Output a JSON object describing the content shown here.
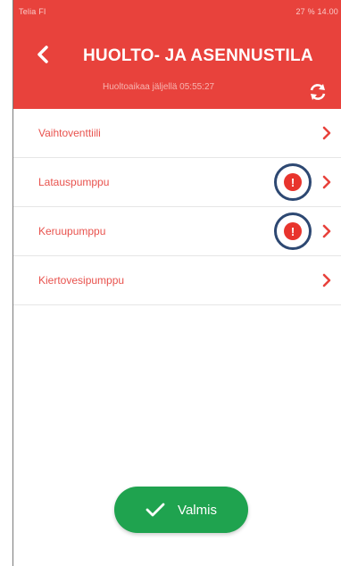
{
  "status_bar": {
    "left": "Telia FI",
    "right": "27 % 14.00"
  },
  "header": {
    "title": "HUOLTO- JA ASENNUSTILA",
    "subtitle": "Huoltoaikaa jäljellä 05:55:27",
    "back_icon": "chevron-left-icon",
    "sync_icon": "sync-icon",
    "background": "#e8423c"
  },
  "items": [
    {
      "label": "Vaihtoventtiili",
      "alert": false
    },
    {
      "label": "Latauspumppu",
      "alert": true
    },
    {
      "label": "Keruupumppu",
      "alert": true
    },
    {
      "label": "Kiertovesipumppu",
      "alert": false
    }
  ],
  "alert_symbol": "!",
  "done_button": {
    "label": "Valmis",
    "icon": "check-icon",
    "color": "#1fa34f"
  },
  "colors": {
    "accent": "#e8423c",
    "row_text": "#e8524d",
    "highlight_ring": "#2d4872"
  }
}
